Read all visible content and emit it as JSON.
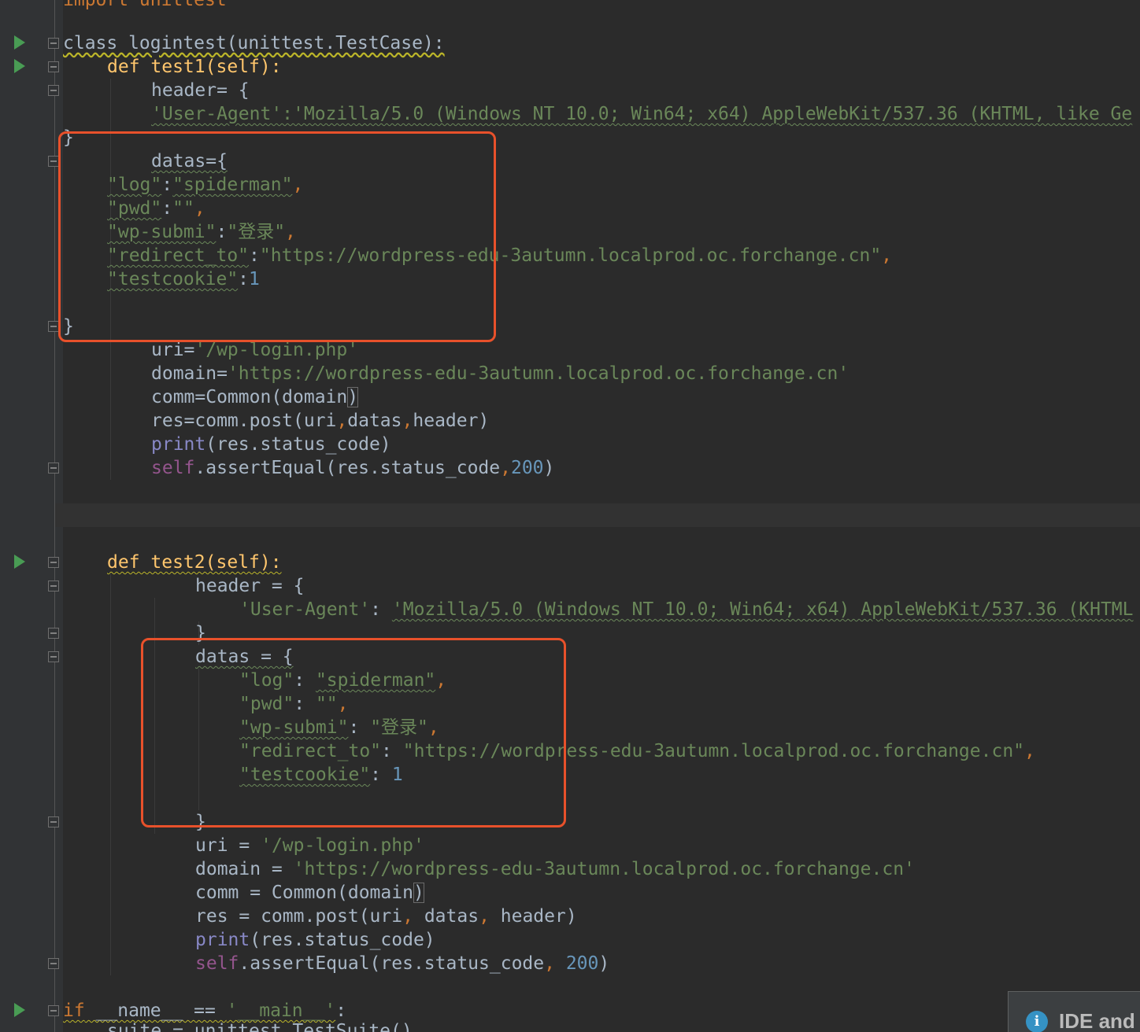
{
  "editor": {
    "lines": {
      "l00": "import unittest",
      "l01": "class logintest(unittest.TestCase):",
      "l02": "def test1(self):",
      "l03": "header= {",
      "l04": "'User-Agent':'Mozilla/5.0 (Windows NT 10.0; Win64; x64) AppleWebKit/537.36 (KHTML, like Ge",
      "l05": "}",
      "l06": "datas={",
      "l07_key": "\"log\"",
      "l07_val": "\"spiderman\"",
      "l08_key": "\"pwd\"",
      "l08_val": "\"\"",
      "l09_key": "\"wp-submi\"",
      "l09_val": "\"登录\"",
      "l10_key": "\"redirect_to\"",
      "l10_val": "\"https://wordpress-edu-3autumn.localprod.oc.forchange.cn\"",
      "l11_key": "\"testcookie\"",
      "l11_val": "1",
      "l12": "}",
      "l13_lhs": "uri=",
      "l13_val": "'/wp-login.php'",
      "l14_lhs": "domain=",
      "l14_val": "'https://wordpress-edu-3autumn.localprod.oc.forchange.cn'",
      "l15_lhs": "comm=Common(domain",
      "l15_paren": ")",
      "l16_a": "res=comm.post(uri",
      "l16_b": "datas",
      "l16_c": "header)",
      "l17_a": "print",
      "l17_b": "(res.status_code)",
      "l18_a": "self",
      "l18_b": ".assertEqual(res.status_code",
      "l18_c": "200",
      "l18_d": ")",
      "l19": "def test2(self):",
      "l20": "header = {",
      "l21_key": "'User-Agent'",
      "l21_val": "'Mozilla/5.0 (Windows NT 10.0; Win64; x64) AppleWebKit/537.36 (KHTML",
      "l22": "}",
      "l23": "datas = {",
      "l24_key": "\"log\"",
      "l24_val": "\"spiderman\"",
      "l25_key": "\"pwd\"",
      "l25_val": "\"\"",
      "l26_key": "\"wp-submi\"",
      "l26_val": "\"登录\"",
      "l27_key": "\"redirect_to\"",
      "l27_val": "\"https://wordpress-edu-3autumn.localprod.oc.forchange.cn\"",
      "l28_key": "\"testcookie\"",
      "l28_val": "1",
      "l29": "}",
      "l30_lhs": "uri = ",
      "l30_val": "'/wp-login.php'",
      "l31_lhs": "domain = ",
      "l31_val": "'https://wordpress-edu-3autumn.localprod.oc.forchange.cn'",
      "l32_lhs": "comm = Common(domain",
      "l32_paren": ")",
      "l33_a": "res = comm.post(uri",
      "l33_b": " datas",
      "l33_c": " header)",
      "l34_a": "print",
      "l34_b": "(res.status_code)",
      "l35_a": "self",
      "l35_b": ".assertEqual(res.status_code",
      "l35_c": " 200",
      "l35_d": ")",
      "l36_kw": "if",
      "l36_a": " __name__ == ",
      "l36_str": "'__main__'",
      "l36_b": ":",
      "l37": "suite = unittest.TestSuite()"
    }
  },
  "notification": {
    "title": "IDE and"
  },
  "colors": {
    "background": "#2b2b2b",
    "keyword": "#cc7832",
    "string": "#6a8759",
    "number": "#6897bb",
    "function": "#ffc66d",
    "self": "#94558d",
    "highlight_box": "#e8512b",
    "run_icon": "#499c54"
  },
  "icons": {
    "run": "run-gutter-icon",
    "fold": "fold-marker-icon",
    "info": "info-icon"
  }
}
